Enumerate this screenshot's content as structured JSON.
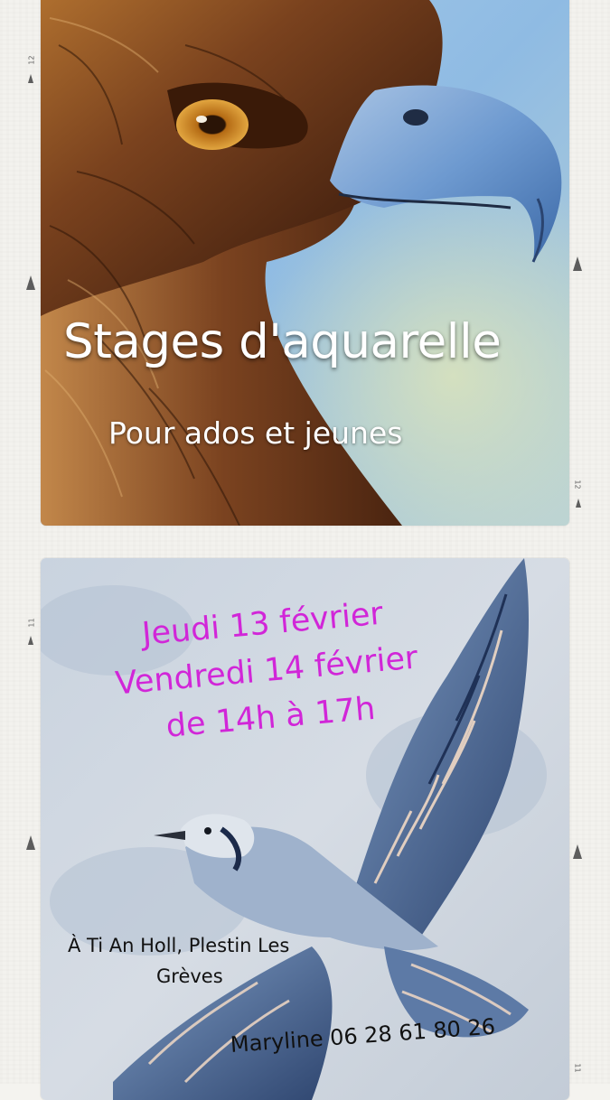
{
  "top_card": {
    "title": "Stages d'aquarelle",
    "subtitle": "Pour ados et jeunes"
  },
  "bottom_card": {
    "dates": [
      "Jeudi 13 février",
      "Vendredi 14 février",
      "de 14h à 17h"
    ],
    "location_line1": "À Ti An Holl, Plestin Les",
    "location_line2": "Grèves",
    "contact": "Maryline 06 28 61 80 26"
  },
  "ruler": {
    "top_left": "12",
    "top_right": "12",
    "bottom_left": "11",
    "bottom_right": "11"
  },
  "colors": {
    "date_text": "#d126d8",
    "sky": "#9cc3e6",
    "eagle_brown": "#6b3a1c",
    "beak_blue": "#6f98c8",
    "bird_blue": "#3e5a86"
  }
}
